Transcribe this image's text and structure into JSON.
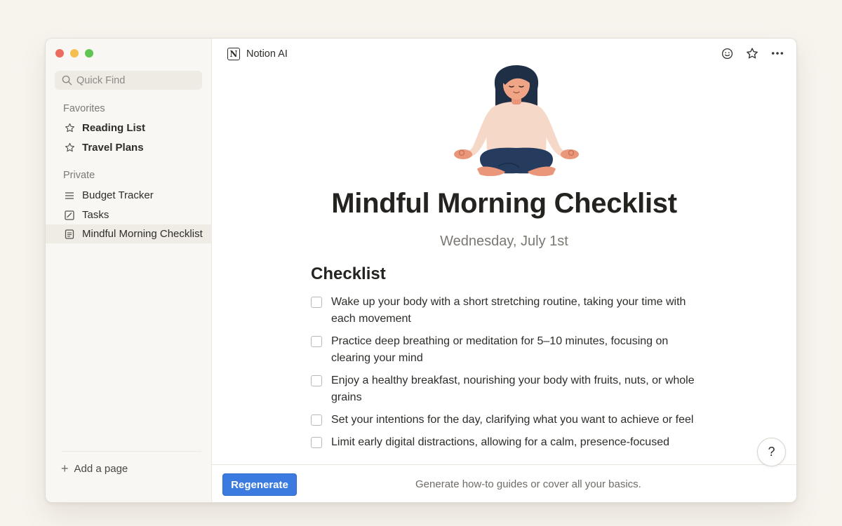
{
  "sidebar": {
    "quick_find_placeholder": "Quick Find",
    "favorites_label": "Favorites",
    "favorites": [
      {
        "label": "Reading List",
        "icon": "star-icon"
      },
      {
        "label": "Travel Plans",
        "icon": "star-icon"
      }
    ],
    "private_label": "Private",
    "private": [
      {
        "label": "Budget Tracker",
        "icon": "list-icon"
      },
      {
        "label": "Tasks",
        "icon": "checkbox-icon"
      },
      {
        "label": "Mindful Morning Checklist",
        "icon": "document-icon",
        "active": true
      }
    ],
    "add_page_label": "Add a page"
  },
  "topbar": {
    "title": "Notion AI",
    "logo_letter": "N"
  },
  "document": {
    "title": "Mindful Morning Checklist",
    "date": "Wednesday, July 1st",
    "heading": "Checklist",
    "items": [
      {
        "text": "Wake up your body with a short stretching routine, taking your time with each movement",
        "checked": false
      },
      {
        "text": "Practice deep breathing or meditation for 5–10 minutes, focusing on clearing your mind",
        "checked": false
      },
      {
        "text": "Enjoy a healthy breakfast, nourishing your body with fruits, nuts, or whole grains",
        "checked": false
      },
      {
        "text": "Set your intentions for the day, clarifying what you want to achieve or feel",
        "checked": false
      },
      {
        "text": "Limit early digital distractions, allowing for a calm, presence-focused",
        "checked": false
      }
    ]
  },
  "help_label": "?",
  "bottombar": {
    "regenerate_label": "Regenerate",
    "hint": "Generate how-to guides or cover all your basics."
  },
  "colors": {
    "accent": "#3b7be0",
    "sidebar_bg": "#f9f7f3",
    "page_bg": "#f7f4ee"
  }
}
